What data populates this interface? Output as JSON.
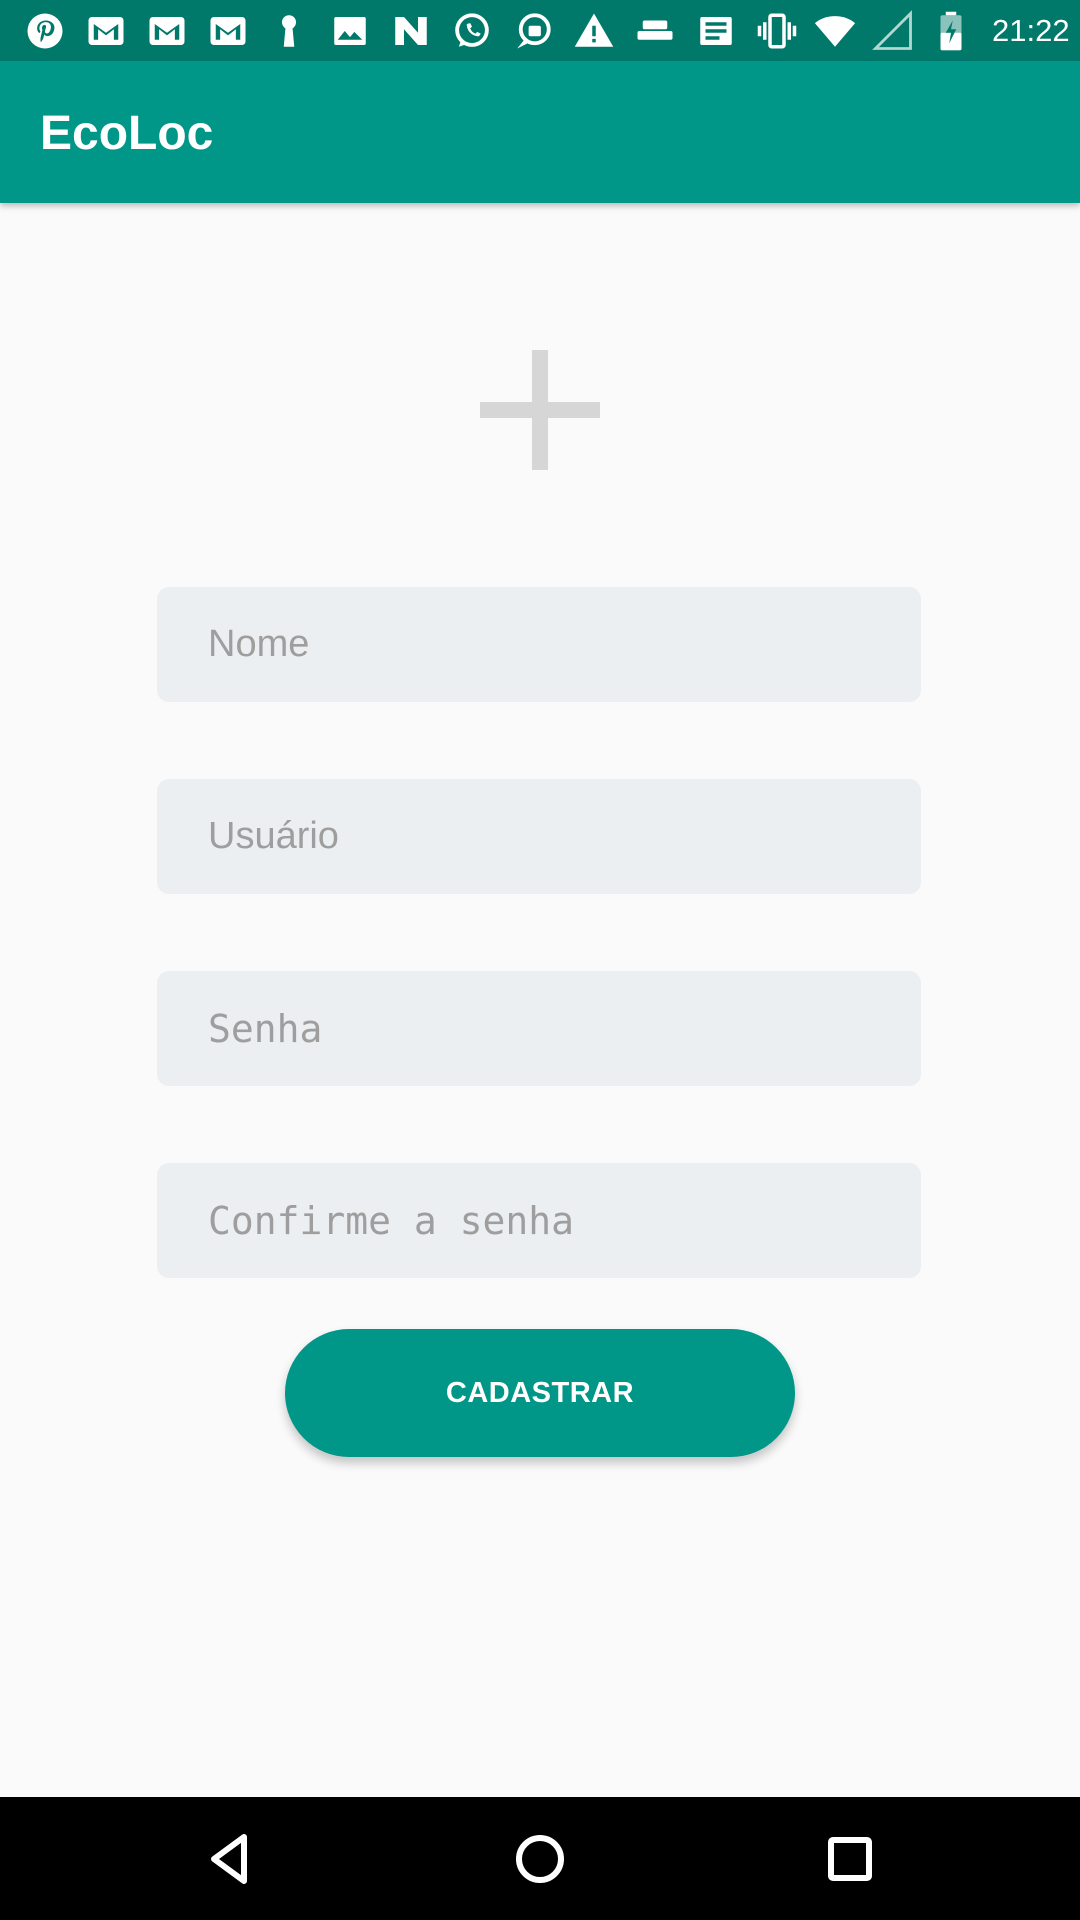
{
  "status_bar": {
    "time": "21:22",
    "notification_icons": [
      "pinterest-icon",
      "gmail-icon",
      "gmail-icon",
      "gmail-icon",
      "keyhole-icon",
      "image-icon",
      "n-app-icon",
      "whatsapp-icon",
      "chat-bag-icon",
      "alert-icon",
      "tray-icon",
      "news-icon"
    ],
    "system_icons": [
      "vibrate-icon",
      "wifi-icon",
      "signal-icon",
      "battery-charging-icon"
    ]
  },
  "app_bar": {
    "title": "EcoLoc"
  },
  "form": {
    "add_photo_icon": "plus-icon",
    "name_placeholder": "Nome",
    "user_placeholder": "Usuário",
    "password_placeholder": "Senha",
    "confirm_placeholder": "Confirme a senha",
    "submit_label": "CADASTRAR"
  },
  "nav_bar": {
    "buttons": [
      "back-icon",
      "home-icon",
      "recents-icon"
    ]
  },
  "colors": {
    "primary": "#009688",
    "primary_dark": "#00796b",
    "field_bg": "#eceff1",
    "background": "#fafafa",
    "placeholder": "#9e9e9e"
  }
}
